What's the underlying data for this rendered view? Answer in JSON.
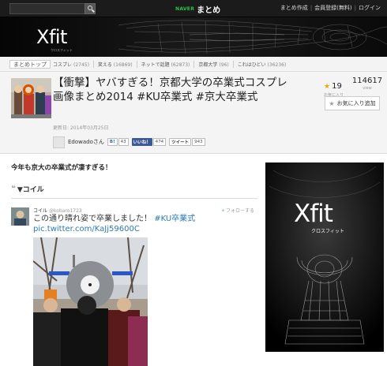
{
  "topbar": {
    "search_placeholder": "",
    "brand_naver": "NAVER",
    "brand_matome": "まとめ",
    "links": [
      "まとめ作成",
      "会員登録(無料)",
      "ログイン"
    ]
  },
  "banner": {
    "logo": "Xfit",
    "logo_sub": "クロスフィット"
  },
  "nav": {
    "home": "まとめトップ",
    "items": [
      {
        "label": "コスプレ",
        "count": "(2745)"
      },
      {
        "label": "笑える",
        "count": "(16869)"
      },
      {
        "label": "ネットで話題",
        "count": "(62873)"
      },
      {
        "label": "京都大学",
        "count": "(96)"
      },
      {
        "label": "これはひどい",
        "count": "(36236)"
      }
    ]
  },
  "article": {
    "title": "【衝撃】ヤバすぎる！京都大学の卒業式コスプレ画像まとめ2014 #KU卒業式 #京大卒業式",
    "updated": "更新日: 2014年03月25日",
    "favorites_count": "19",
    "favorites_label": "お気に入り",
    "views_count": "114617",
    "views_label": "view",
    "fav_button": "お気に入り追加",
    "author": "Edowadoさん",
    "shares": {
      "hatena_label": "B!",
      "hatena_count": "43",
      "facebook_label": "いいね！",
      "facebook_count": "474",
      "twitter_label": "ツイート",
      "twitter_count": "943"
    }
  },
  "content": {
    "lead": "今年も京大の卒業式が凄すぎる！",
    "section_heading": "▼コイル",
    "tweet": {
      "name": "コイル",
      "handle": "@kobaro1723",
      "follow": "フォローする",
      "text": "この通り晴れ姿で卒業しました！ ",
      "hashtag": "#KU卒業式",
      "link": "pic.twitter.com/KaJj59600C"
    }
  },
  "ad": {
    "logo": "Xfit",
    "logo_sub": "クロスフィット"
  },
  "colors": {
    "topbar": "#1b1b1b",
    "naver_green": "#27c44b",
    "link_blue": "#2a7ab7",
    "facebook_blue": "#3b5998",
    "star_gold": "#f5a700"
  }
}
